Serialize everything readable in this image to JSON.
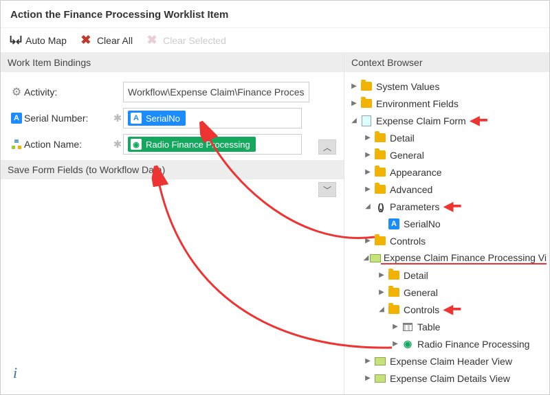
{
  "title": "Action the Finance Processing Worklist Item",
  "toolbar": {
    "automap": "Auto Map",
    "clearall": "Clear All",
    "clearsel": "Clear Selected"
  },
  "left": {
    "panel_title": "Work Item Bindings",
    "rows": {
      "activity": {
        "label": "Activity:",
        "value": "Workflow\\Expense Claim\\Finance Proces"
      },
      "serial": {
        "label": "Serial Number:",
        "chip": "SerialNo"
      },
      "action": {
        "label": "Action Name:",
        "chip": "Radio Finance Processing"
      }
    },
    "section": "Save Form Fields (to Workflow Data)"
  },
  "right": {
    "panel_title": "Context Browser",
    "tree": {
      "system_values": "System Values",
      "environment_fields": "Environment Fields",
      "expense_claim_form": "Expense Claim Form",
      "detail": "Detail",
      "general": "General",
      "appearance": "Appearance",
      "advanced": "Advanced",
      "parameters": "Parameters",
      "serialno": "SerialNo",
      "controls": "Controls",
      "ecfp_view": "Expense Claim Finance Processing Vi",
      "detail2": "Detail",
      "general2": "General",
      "controls2": "Controls",
      "table": "Table",
      "radio_fp": "Radio Finance Processing",
      "header_view": "Expense Claim Header View",
      "details_view": "Expense Claim Details View"
    }
  }
}
